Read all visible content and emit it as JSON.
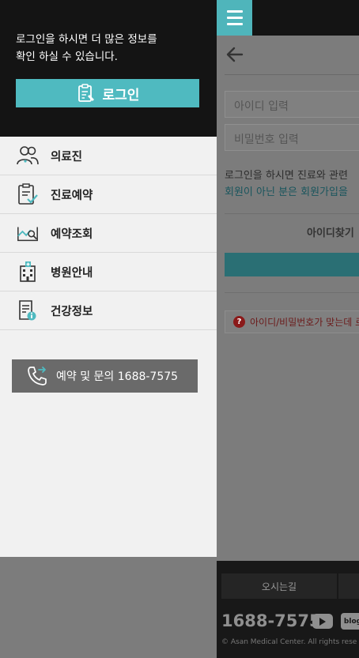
{
  "drawer": {
    "intro_line1": "로그인을 하시면 더 많은 정보를",
    "intro_line2": "확인 하실 수 있습니다.",
    "login_label": "로그인",
    "menu": [
      {
        "label": "의료진",
        "icon": "doctors-icon"
      },
      {
        "label": "진료예약",
        "icon": "clipboard-check-icon"
      },
      {
        "label": "예약조회",
        "icon": "chart-search-icon"
      },
      {
        "label": "병원안내",
        "icon": "hospital-building-icon"
      },
      {
        "label": "건강정보",
        "icon": "document-info-icon"
      }
    ],
    "call_label": "예약 및 문의 1688-7575",
    "accent_color": "#4fbac0"
  },
  "page": {
    "id_placeholder": "아이디 입력",
    "pw_placeholder": "비밀번호 입력",
    "notice_line1": "로그인을 하시면 진료와 관련",
    "notice_line2": "회원이 아닌 분은 회원가입을",
    "find_id_label": "아이디찾기",
    "warning_text": "아이디/비밀번호가 맞는데 로",
    "footer": {
      "directions_label": "오시는길",
      "phone": "1688-7575",
      "blog_label": "blog",
      "copyright": "© Asan Medical Center. All rights rese"
    }
  }
}
